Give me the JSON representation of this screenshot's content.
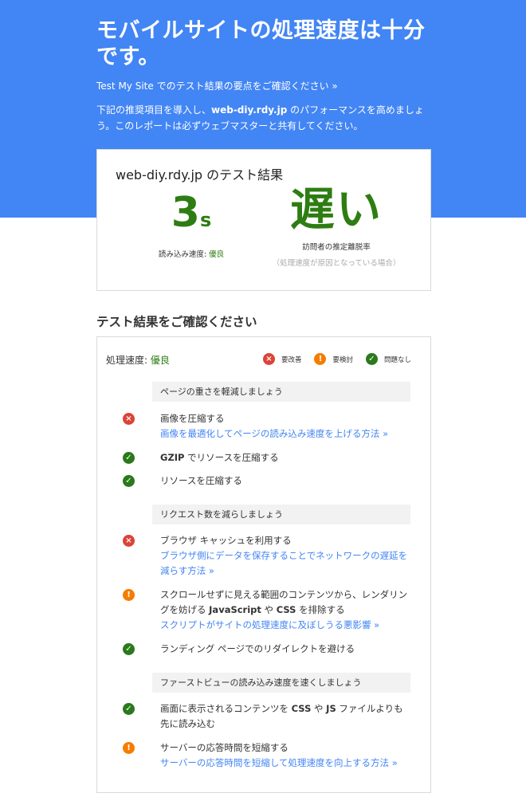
{
  "hero": {
    "title": "モバイルサイトの処理速度は十分です。",
    "link_text": "Test My Site でのテスト結果の要点をご確認ください »",
    "desc_pre": "下記の推奨項目を導入し、",
    "desc_site": "web-diy.rdy.jp",
    "desc_post": " のパフォーマンスを高めましょう。このレポートは必ずウェブマスターと共有してください。"
  },
  "score_card": {
    "site_heading": "web-diy.rdy.jp のテスト結果",
    "speed_value": "3",
    "speed_unit": "s",
    "speed_label": "読み込み速度: ",
    "speed_grade": "優良",
    "bounce_value": "遅い",
    "bounce_label": "訪問者の推定離脱率",
    "bounce_note": "（処理速度が原因となっている場合）"
  },
  "section_title": "テスト結果をご確認ください",
  "results": {
    "head_label": "処理速度: ",
    "head_grade": "優良",
    "legend": {
      "red_label": "要改善",
      "orange_label": "要検討",
      "green_label": "問題なし"
    },
    "groups": [
      {
        "header": "ページの重さを軽減しましょう",
        "items": [
          {
            "title": "画像を圧縮する",
            "link": "画像を最適化してページの読み込み速度を上げる方法 »"
          },
          {
            "title_bold": "GZIP",
            "title": " でリソースを圧縮する"
          },
          {
            "title": "リソースを圧縮する"
          }
        ]
      },
      {
        "header": "リクエスト数を減らしましょう",
        "items": [
          {
            "title": "ブラウザ キャッシュを利用する",
            "link": "ブラウザ側にデータを保存することでネットワークの遅延を減らす方法 »"
          },
          {
            "title_a": "スクロールせずに見える範囲のコンテンツから、レンダリングを妨げる ",
            "title_b1": "JavaScript",
            "title_c": " や ",
            "title_b2": "CSS",
            "title_d": " を排除する",
            "link": "スクリプトがサイトの処理速度に及ぼしうる悪影響 »"
          },
          {
            "title": "ランディング ページでのリダイレクトを避ける"
          }
        ]
      },
      {
        "header": "ファーストビューの読み込み速度を速くしましょう",
        "items": [
          {
            "title_a": "画面に表示されるコンテンツを ",
            "title_b1": "CSS",
            "title_c": " や ",
            "title_b2": "JS",
            "title_d": " ファイルよりも先に読み込む"
          },
          {
            "title": "サーバーの応答時間を短縮する",
            "link": "サーバーの応答時間を短縮して処理速度を向上する方法 »"
          }
        ]
      }
    ]
  }
}
